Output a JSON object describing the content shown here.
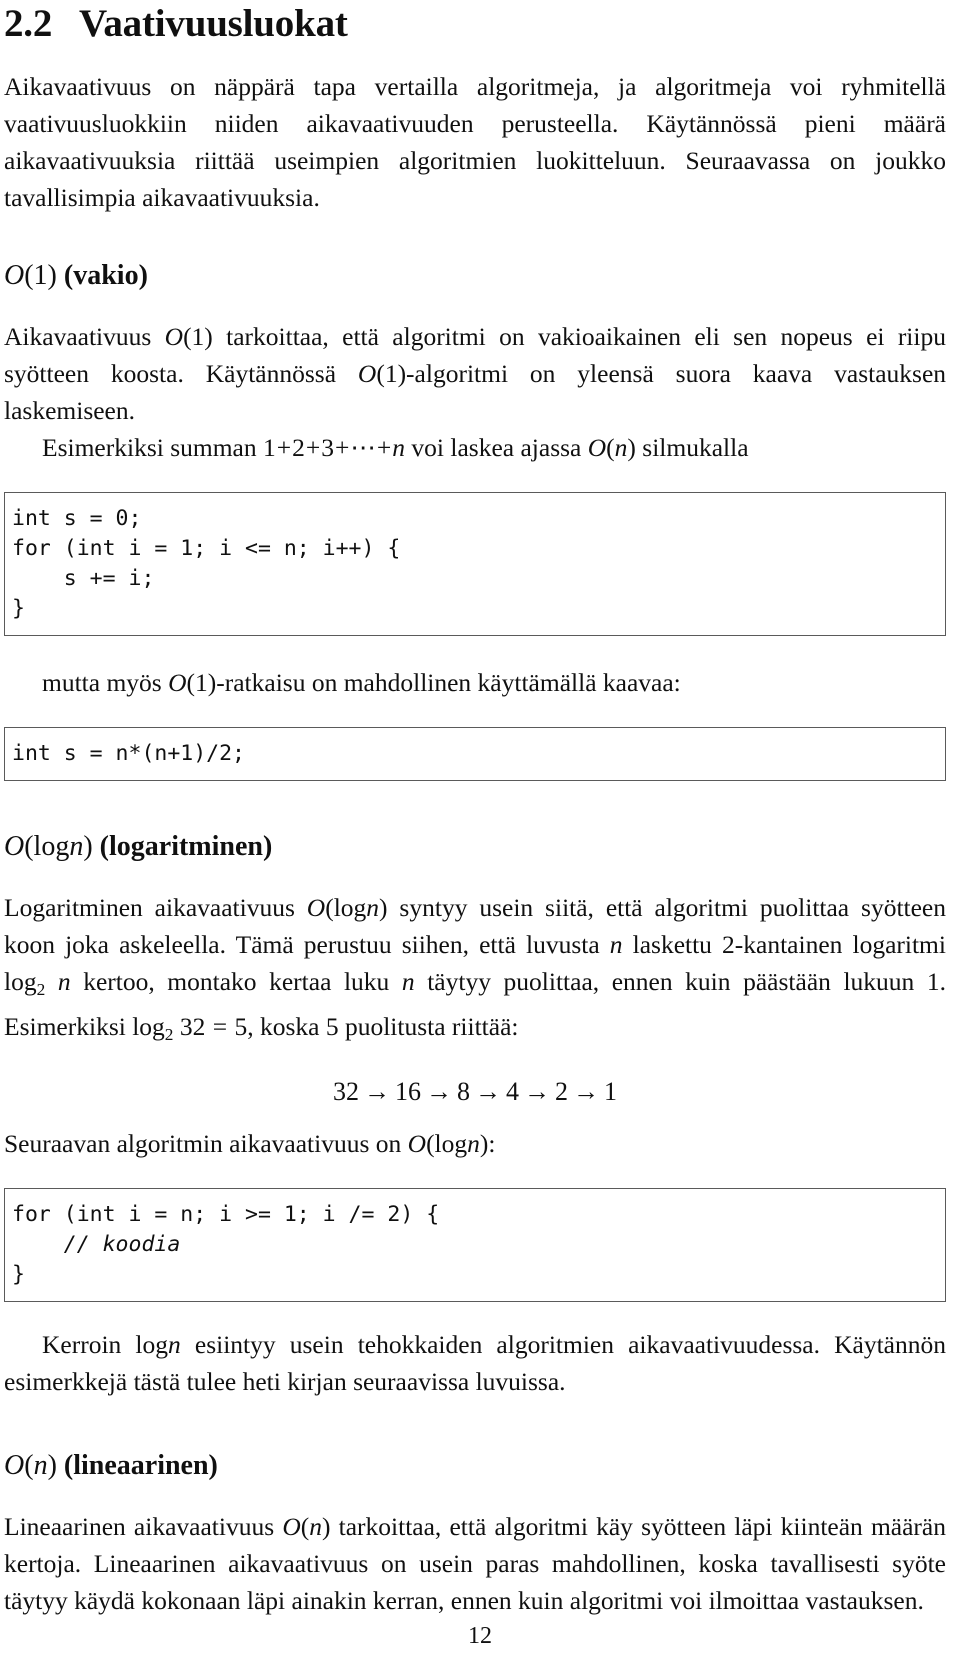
{
  "document": {
    "section_number": "2.2",
    "section_title": "Vaativuusluokat",
    "page_number": "12",
    "intro_paragraph": "Aikavaativuus on näppärä tapa vertailla algoritmeja, ja algoritmeja voi ryhmitellä vaativuusluokkiin niiden aikavaativuuden perusteella. Käytännössä pieni määrä aikavaativuuksia riittää useimpien algoritmien luokitteluun. Seuraavassa on joukko tavallisimpia aikavaativuuksia."
  },
  "subsections": {
    "constant": {
      "heading_math": "O(1)",
      "heading_label": "(vakio)",
      "paragraph_1": "Aikavaativuus O(1) tarkoittaa, että algoritmi on vakioaikainen eli sen nopeus ei riipu syötteen koosta. Käytännössä O(1)-algoritmi on yleensä suora kaava vastauksen laskemiseen.",
      "paragraph_2": "Esimerkiksi summan 1 + 2 + 3 + ⋯ + n voi laskea ajassa O(n) silmukalla",
      "code_1": "int s = 0;\nfor (int i = 1; i <= n; i++) {\n    s += i;\n}",
      "paragraph_3": "mutta myös O(1)-ratkaisu on mahdollinen käyttämällä kaavaa:",
      "code_2": "int s = n*(n+1)/2;"
    },
    "logarithmic": {
      "heading_math": "O(log n)",
      "heading_label": "(logaritminen)",
      "paragraph_1": "Logaritminen aikavaativuus O(log n) syntyy usein siitä, että algoritmi puolittaa syötteen koon joka askeleella. Tämä perustuu siihen, että luvusta n laskettu 2-kantainen logaritmi log₂ n kertoo, montako kertaa luku n täytyy puolittaa, ennen kuin päästään lukuun 1. Esimerkiksi log₂ 32 = 5, koska 5 puolitusta riittää:",
      "display_math": "32 → 16 → 8 → 4 → 2 → 1",
      "display_math_values": [
        "32",
        "16",
        "8",
        "4",
        "2",
        "1"
      ],
      "paragraph_2": "Seuraavan algoritmin aikavaativuus on O(log n):",
      "code_1": "for (int i = n; i >= 1; i /= 2) {\n    // koodia\n}",
      "code_1_line_1": "for (int i = n; i >= 1; i /= 2) {",
      "code_1_comment": "    // koodia",
      "code_1_line_3": "}",
      "paragraph_3": "Kerroin log n esiintyy usein tehokkaiden algoritmien aikavaativuudessa. Käytännön esimerkkejä tästä tulee heti kirjan seuraavissa luvuissa."
    },
    "linear": {
      "heading_math": "O(n)",
      "heading_label": "(lineaarinen)",
      "paragraph_1": "Lineaarinen aikavaativuus O(n) tarkoittaa, että algoritmi käy syötteen läpi kiinteän määrän kertoja. Lineaarinen aikavaativuus on usein paras mahdollinen, koska tavallisesti syöte täytyy käydä kokonaan läpi ainakin kerran, ennen kuin algoritmi voi ilmoittaa vastauksen."
    }
  },
  "colors": {
    "text": "#101010",
    "code_border": "#5a5a5a",
    "background": "#ffffff"
  }
}
